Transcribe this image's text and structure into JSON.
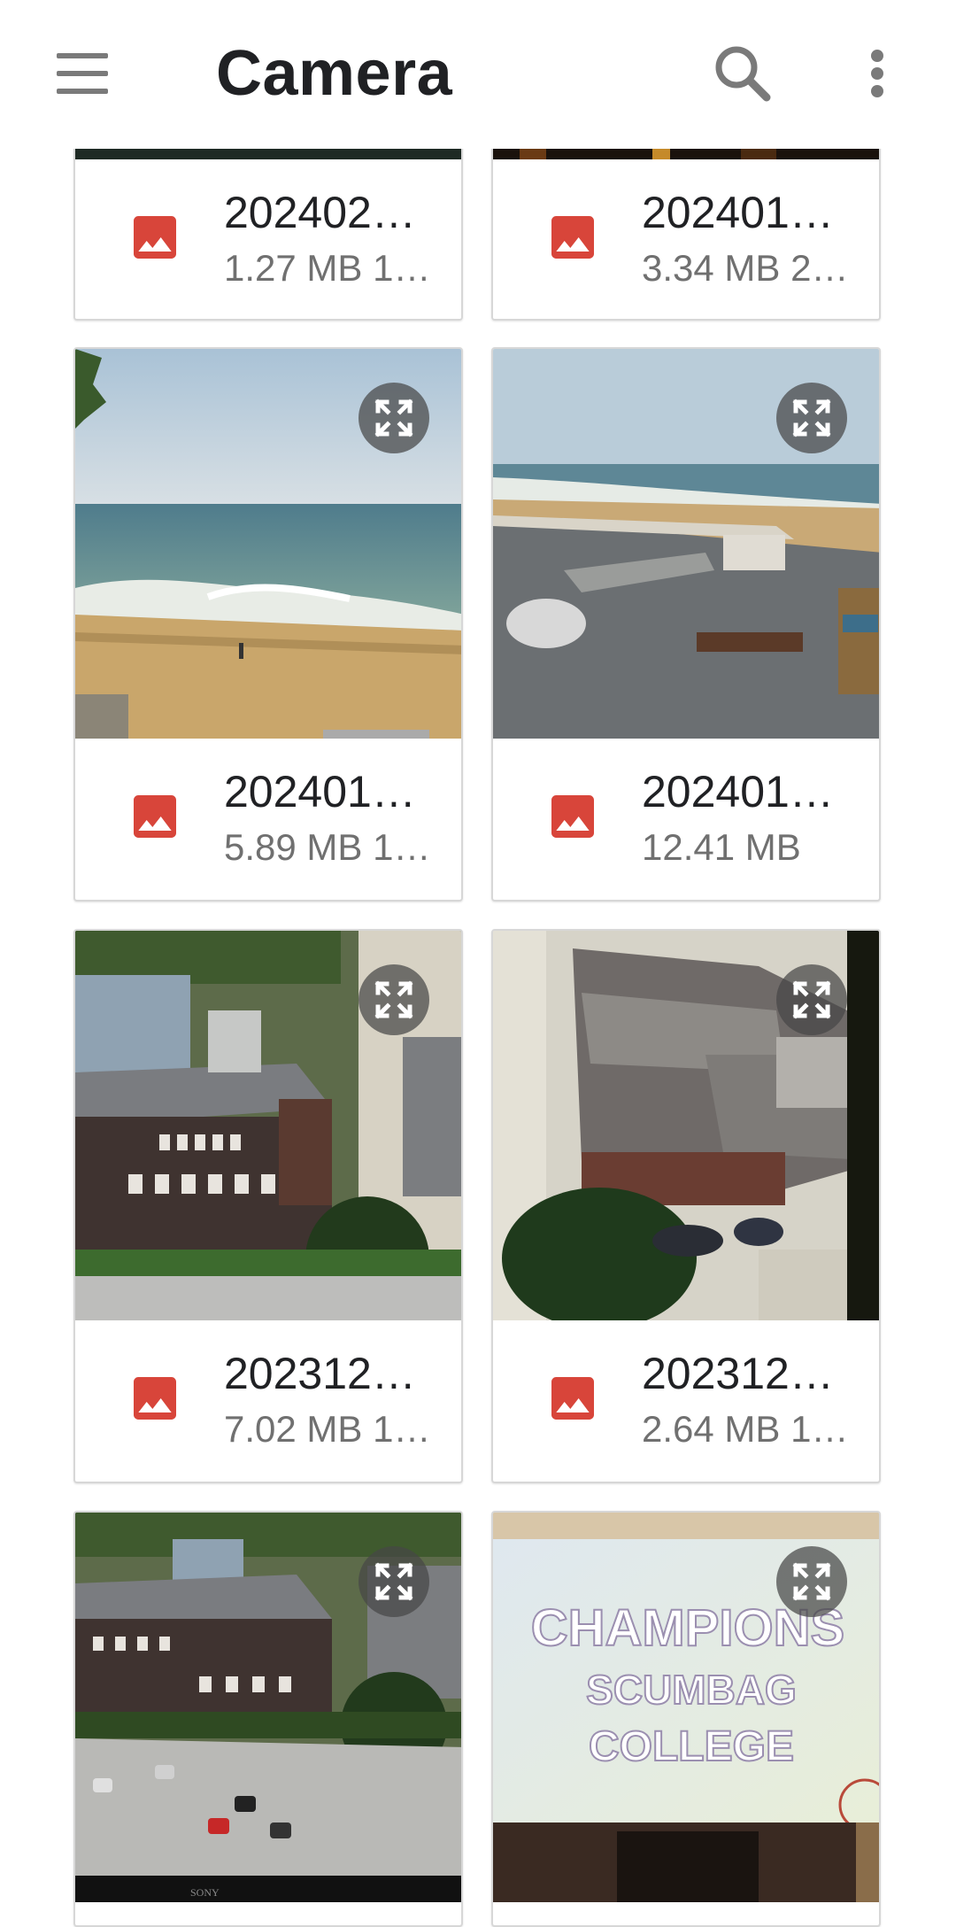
{
  "app_bar": {
    "title": "Camera",
    "menu_icon": "hamburger-menu-icon",
    "search_icon": "search-icon",
    "more_icon": "more-vert-icon"
  },
  "colors": {
    "file_icon": "#d8453a",
    "expand_bg": "#4a4a4a",
    "text_primary": "#202124",
    "text_secondary": "#707070"
  },
  "files": [
    {
      "name": "202402…",
      "meta": "1.27 MB 1…",
      "thumbnail": "dark-night-image"
    },
    {
      "name": "202401…",
      "meta": "3.34 MB 2…",
      "thumbnail": "night-lights-image"
    },
    {
      "name": "202401…",
      "meta": "5.89 MB 1…",
      "thumbnail": "beach-waves-image"
    },
    {
      "name": "202401…",
      "meta": "12.41 MB",
      "thumbnail": "beach-rooftop-image"
    },
    {
      "name": "202312…",
      "meta": "7.02 MB 1…",
      "thumbnail": "aerial-buildings-image"
    },
    {
      "name": "202312…",
      "meta": "2.64 MB 1…",
      "thumbnail": "aerial-rooftops-image"
    },
    {
      "name": "",
      "meta": "",
      "thumbnail": "aerial-car-park-image"
    },
    {
      "name": "",
      "meta": "",
      "thumbnail": "champions-screen-image"
    }
  ],
  "screen_text": {
    "line1": "CHAMPIONS",
    "line2": "SCUMBAG",
    "line3": "COLLEGE",
    "tv_brand": "SONY"
  }
}
